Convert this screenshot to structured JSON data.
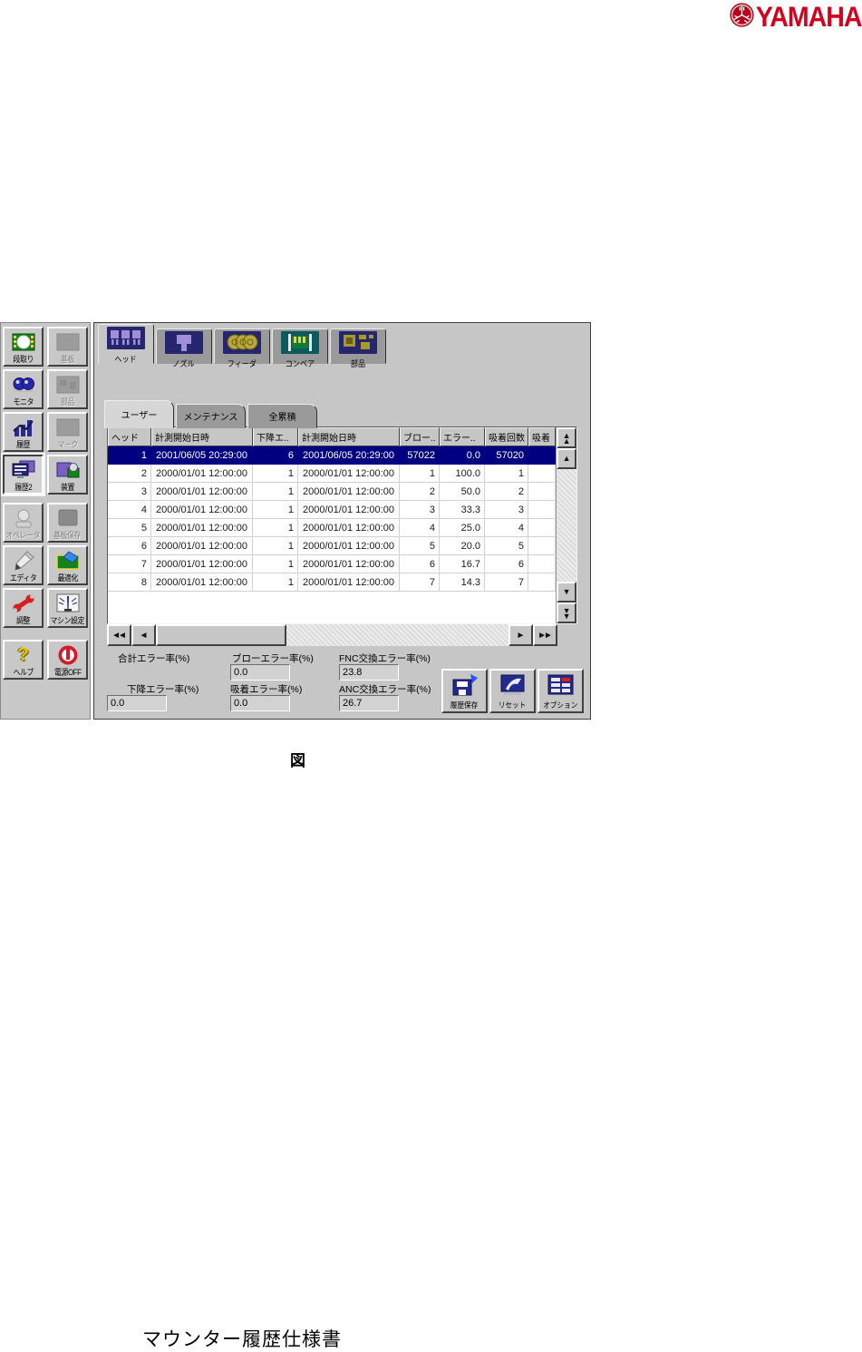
{
  "brand": {
    "name": "YAMAHA",
    "emblem_icon": "yamaha-tuning-fork-emblem",
    "color": "#d4001e"
  },
  "sidebar": {
    "buttons": [
      {
        "label": "段取り",
        "icon": "setup-icon",
        "state": "enabled"
      },
      {
        "label": "基板",
        "icon": "board-icon",
        "state": "disabled"
      },
      {
        "label": "モニタ",
        "icon": "monitor-icon",
        "state": "enabled"
      },
      {
        "label": "部品",
        "icon": "parts-icon",
        "state": "disabled"
      },
      {
        "label": "履歴",
        "icon": "history-icon",
        "state": "enabled"
      },
      {
        "label": "マーク",
        "icon": "mark-icon",
        "state": "disabled"
      },
      {
        "label": "履歴2",
        "icon": "history2-icon",
        "state": "active"
      },
      {
        "label": "装置",
        "icon": "device-icon",
        "state": "enabled"
      },
      {
        "label": "オペレータ",
        "icon": "operator-icon",
        "state": "disabled"
      },
      {
        "label": "基板保存",
        "icon": "board-save-icon",
        "state": "disabled"
      },
      {
        "label": "エディタ",
        "icon": "editor-pencil-icon",
        "state": "enabled"
      },
      {
        "label": "最適化",
        "icon": "optimize-icon",
        "state": "enabled"
      },
      {
        "label": "調整",
        "icon": "wrench-icon",
        "state": "enabled"
      },
      {
        "label": "マシン設定",
        "icon": "machine-settings-icon",
        "state": "enabled"
      },
      {
        "label": "ヘルプ",
        "icon": "help-icon",
        "state": "enabled"
      },
      {
        "label": "電源OFF",
        "icon": "power-off-icon",
        "state": "enabled"
      }
    ]
  },
  "tabs": {
    "items": [
      {
        "label": "ヘッド",
        "icon": "head-icon",
        "active": true
      },
      {
        "label": "ノズル",
        "icon": "nozzle-icon",
        "active": false
      },
      {
        "label": "フィーダ",
        "icon": "feeder-icon",
        "active": false
      },
      {
        "label": "コンベア",
        "icon": "conveyor-icon",
        "active": false
      },
      {
        "label": "部品",
        "icon": "component-icon",
        "active": false
      }
    ]
  },
  "subtabs": {
    "items": [
      {
        "label": "ユーザー",
        "active": true
      },
      {
        "label": "メンテナンス",
        "active": false
      },
      {
        "label": "全累積",
        "active": false
      }
    ]
  },
  "table": {
    "columns": [
      "ヘッド",
      "計測開始日時",
      "下降エ..",
      "計測開始日時",
      "ブロー..",
      "エラー..",
      "吸着回数",
      "吸着"
    ],
    "selected_row_index": 0,
    "rows": [
      [
        "1",
        "2001/06/05 20:29:00",
        "6",
        "2001/06/05 20:29:00",
        "57022",
        "0.0",
        "57020",
        ""
      ],
      [
        "2",
        "2000/01/01 12:00:00",
        "1",
        "2000/01/01 12:00:00",
        "1",
        "100.0",
        "1",
        ""
      ],
      [
        "3",
        "2000/01/01 12:00:00",
        "1",
        "2000/01/01 12:00:00",
        "2",
        "50.0",
        "2",
        ""
      ],
      [
        "4",
        "2000/01/01 12:00:00",
        "1",
        "2000/01/01 12:00:00",
        "3",
        "33.3",
        "3",
        ""
      ],
      [
        "5",
        "2000/01/01 12:00:00",
        "1",
        "2000/01/01 12:00:00",
        "4",
        "25.0",
        "4",
        ""
      ],
      [
        "6",
        "2000/01/01 12:00:00",
        "1",
        "2000/01/01 12:00:00",
        "5",
        "20.0",
        "5",
        ""
      ],
      [
        "7",
        "2000/01/01 12:00:00",
        "1",
        "2000/01/01 12:00:00",
        "6",
        "16.7",
        "6",
        ""
      ],
      [
        "8",
        "2000/01/01 12:00:00",
        "1",
        "2000/01/01 12:00:00",
        "7",
        "14.3",
        "7",
        ""
      ]
    ]
  },
  "stats": {
    "row1": [
      {
        "label": "合計エラー率(%)",
        "value": ""
      },
      {
        "label": "ブローエラー率(%)",
        "value": "0.0"
      },
      {
        "label": "FNC交換エラー率(%)",
        "value": "23.8"
      }
    ],
    "row2": [
      {
        "label": "下降エラー率(%)",
        "value": "0.0"
      },
      {
        "label": "吸着エラー率(%)",
        "value": "0.0"
      },
      {
        "label": "ANC交換エラー率(%)",
        "value": "26.7"
      }
    ]
  },
  "actions": [
    {
      "label": "履歴保存",
      "icon": "save-history-icon"
    },
    {
      "label": "リセット",
      "icon": "reset-icon"
    },
    {
      "label": "オプション",
      "icon": "options-icon"
    }
  ],
  "icons": {
    "arrow_up": "▲",
    "arrow_down": "▼",
    "arrow_left": "◄",
    "arrow_right": "►",
    "help_glyph": "?"
  },
  "caption": {
    "text": "図"
  },
  "footer": {
    "text": "マウンター履歴仕様書"
  }
}
